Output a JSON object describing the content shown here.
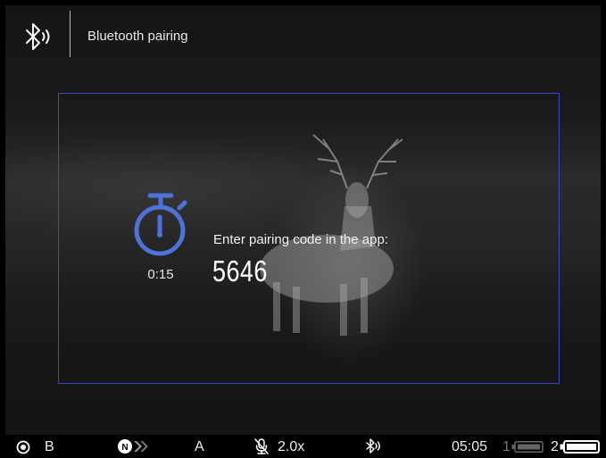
{
  "header": {
    "title": "Bluetooth pairing",
    "icon": "bluetooth-icon"
  },
  "pairing": {
    "timer": "0:15",
    "label": "Enter pairing code in the app:",
    "code": "5646",
    "accent_color": "#4f72d8",
    "frame_color": "#3f48c8"
  },
  "statusbar": {
    "record_mode": "B",
    "mode_letter": "A",
    "zoom": "2.0x",
    "time": "05:05",
    "battery1_label": "1",
    "battery2_label": "2"
  }
}
